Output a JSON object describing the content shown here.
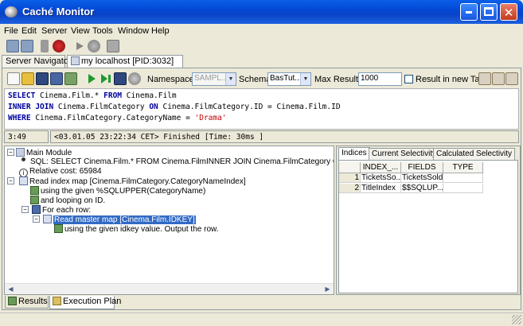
{
  "window": {
    "title": "Caché Monitor"
  },
  "menu": [
    "File",
    "Edit",
    "Server",
    "View",
    "Tools",
    "Window",
    "Help"
  ],
  "doc_tabs": [
    {
      "label": "Server Navigator",
      "active": false
    },
    {
      "label": "my localhost [PID:3032]",
      "active": true
    }
  ],
  "query_toolbar": {
    "namespace_label": "Namespace",
    "namespace_value": "SAMPL...",
    "schema_label": "Schema",
    "schema_value": "BasTut...",
    "max_results_label": "Max Results:",
    "max_results_value": "1000",
    "result_new_tab_label": "Result in new Tab",
    "result_new_tab_checked": false
  },
  "sql": {
    "line1": {
      "kw1": "SELECT",
      "t1": " Cinema.Film.* ",
      "kw2": "FROM",
      "t2": " Cinema.Film"
    },
    "line2": {
      "kw1": "INNER JOIN",
      "t1": " Cinema.FilmCategory ",
      "kw2": "ON",
      "t2": " Cinema.FilmCategory.ID = Cinema.Film.ID"
    },
    "line3": {
      "kw1": "WHERE",
      "t1": " Cinema.FilmCategory.CategoryName = ",
      "str": "'Drama'"
    }
  },
  "status": {
    "position": "3:49",
    "message": "<03.01.05 23:22:34 CET> Finished  [Time: 30ms ]"
  },
  "plan": {
    "root": "Main Module",
    "sql": "SQL: SELECT Cinema.Film.* FROM Cinema.FilmINNER JOIN Cinema.FilmCategory ON Cinema.FilmCat",
    "cost": "Relative cost: 65984",
    "read_index": "Read index map [Cinema.FilmCategory.CategoryNameIndex]",
    "using_given": "using the given %SQLUPPER(CategoryName)",
    "looping": "and looping on ID.",
    "for_each": "For each row:",
    "read_master": "Read master map [Cinema.Film.IDKEY]",
    "using_idkey": "using the given idkey value.   Output the row."
  },
  "selectivity_tabs": [
    "Indices",
    "Current Selectivity",
    "Calculated Selectivity"
  ],
  "indices_table": {
    "headers": [
      "INDEX_...",
      "FIELDS",
      "TYPE"
    ],
    "rows": [
      {
        "num": "1",
        "index": "TicketsSo...",
        "fields": "TicketsSold",
        "type": ""
      },
      {
        "num": "2",
        "index": "TitleIndex",
        "fields": "$$SQLUP...",
        "type": ""
      }
    ]
  },
  "bottom_tabs": [
    "Results",
    "Execution Plan"
  ],
  "colors": {
    "title_bar": "#0349d6",
    "sql_keyword": "#00009e",
    "sql_string": "#c00000",
    "selection": "#316ac5"
  }
}
